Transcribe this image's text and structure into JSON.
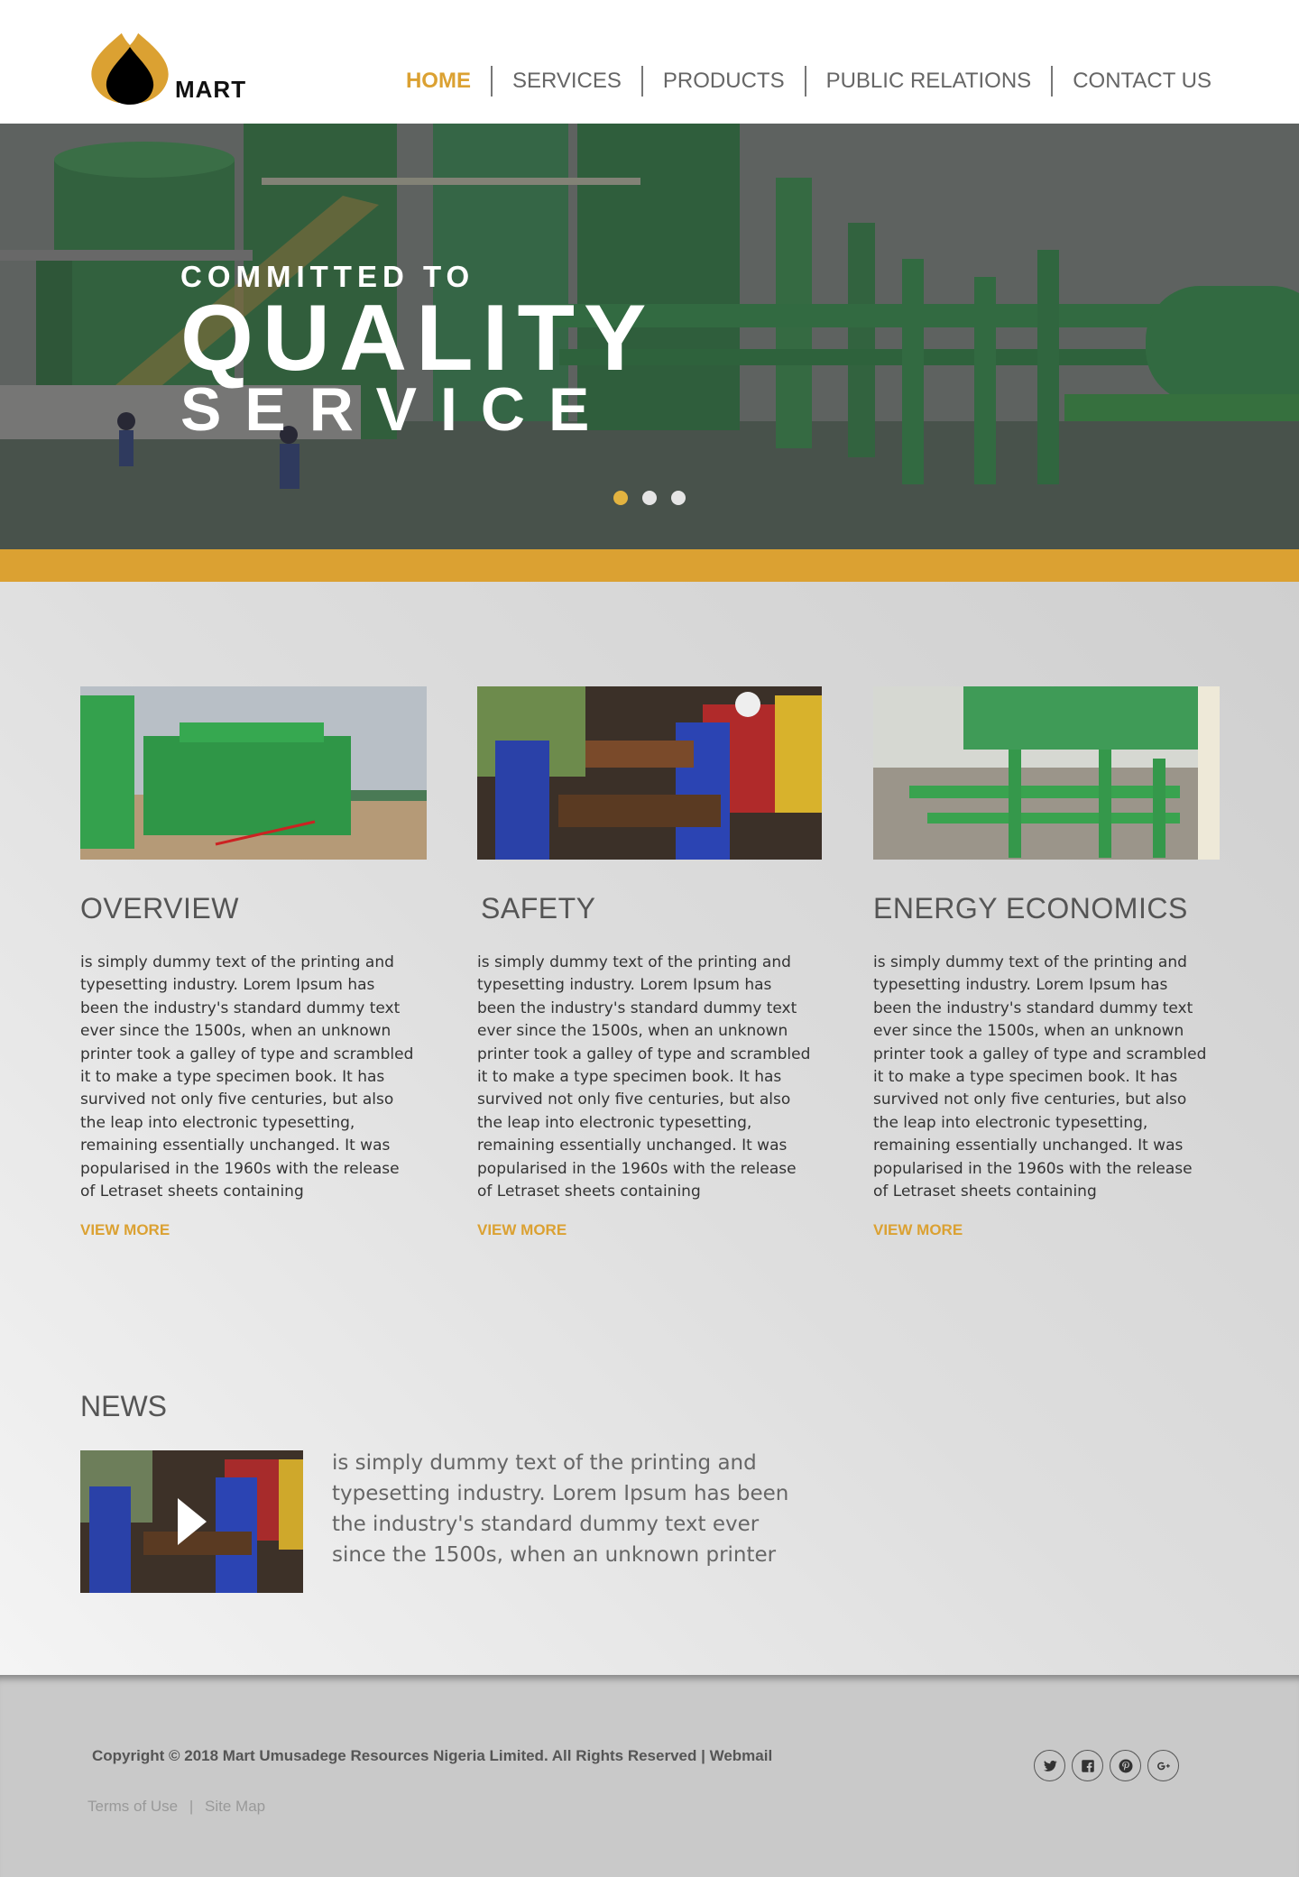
{
  "brand": {
    "name": "MART",
    "colors": {
      "gold": "#dba132",
      "dark": "#333333"
    }
  },
  "nav": {
    "items": [
      {
        "label": "HOME",
        "active": true
      },
      {
        "label": "SERVICES",
        "active": false
      },
      {
        "label": "PRODUCTS",
        "active": false
      },
      {
        "label": "PUBLIC RELATIONS",
        "active": false
      },
      {
        "label": "CONTACT US",
        "active": false
      }
    ]
  },
  "hero": {
    "kicker": "COMMITTED TO",
    "title": "QUALITY",
    "subtitle": "SERVICE",
    "slides": 3,
    "active_slide": 0
  },
  "features": [
    {
      "title": "OVERVIEW",
      "text": "is simply dummy text of the printing and typesetting industry. Lorem Ipsum has been the industry's standard dummy text ever since the 1500s, when an unknown printer took a galley of type and scrambled it to make a type specimen book. It has survived not only five centuries, but also the leap into electronic typesetting, remaining essentially unchanged. It was popularised in the 1960s with the release of Letraset sheets containing",
      "link": "VIEW MORE"
    },
    {
      "title": "SAFETY",
      "text": "is simply dummy text of the printing and typesetting industry. Lorem Ipsum has been the industry's standard dummy text ever since the 1500s, when an unknown printer took a galley of type and scrambled it to make a type specimen book. It has survived not only five centuries, but also the leap into electronic typesetting, remaining essentially unchanged. It was popularised in the 1960s with the release of Letraset sheets containing",
      "link": "VIEW MORE"
    },
    {
      "title": "ENERGY ECONOMICS",
      "text": "is simply dummy text of the printing and typesetting industry. Lorem Ipsum has been the industry's standard dummy text ever since the 1500s, when an unknown printer took a galley of type and scrambled it to make a type specimen book. It has survived not only five centuries, but also the leap into electronic typesetting, remaining essentially unchanged. It was popularised in the 1960s with the release of Letraset sheets containing",
      "link": "VIEW MORE"
    }
  ],
  "news": {
    "title": "NEWS",
    "text": "is simply dummy text of the printing and typesetting industry. Lorem Ipsum has been the industry's standard dummy text ever since the 1500s, when an unknown printer"
  },
  "footer": {
    "copyright": "Copyright © 2018 Mart Umusadege Resources Nigeria Limited. All Rights Reserved |",
    "webmail": "Webmail",
    "terms": "Terms of Use",
    "separator": "|",
    "sitemap": "Site Map",
    "social": [
      "twitter-icon",
      "facebook-icon",
      "pinterest-icon",
      "google-plus-icon"
    ]
  }
}
